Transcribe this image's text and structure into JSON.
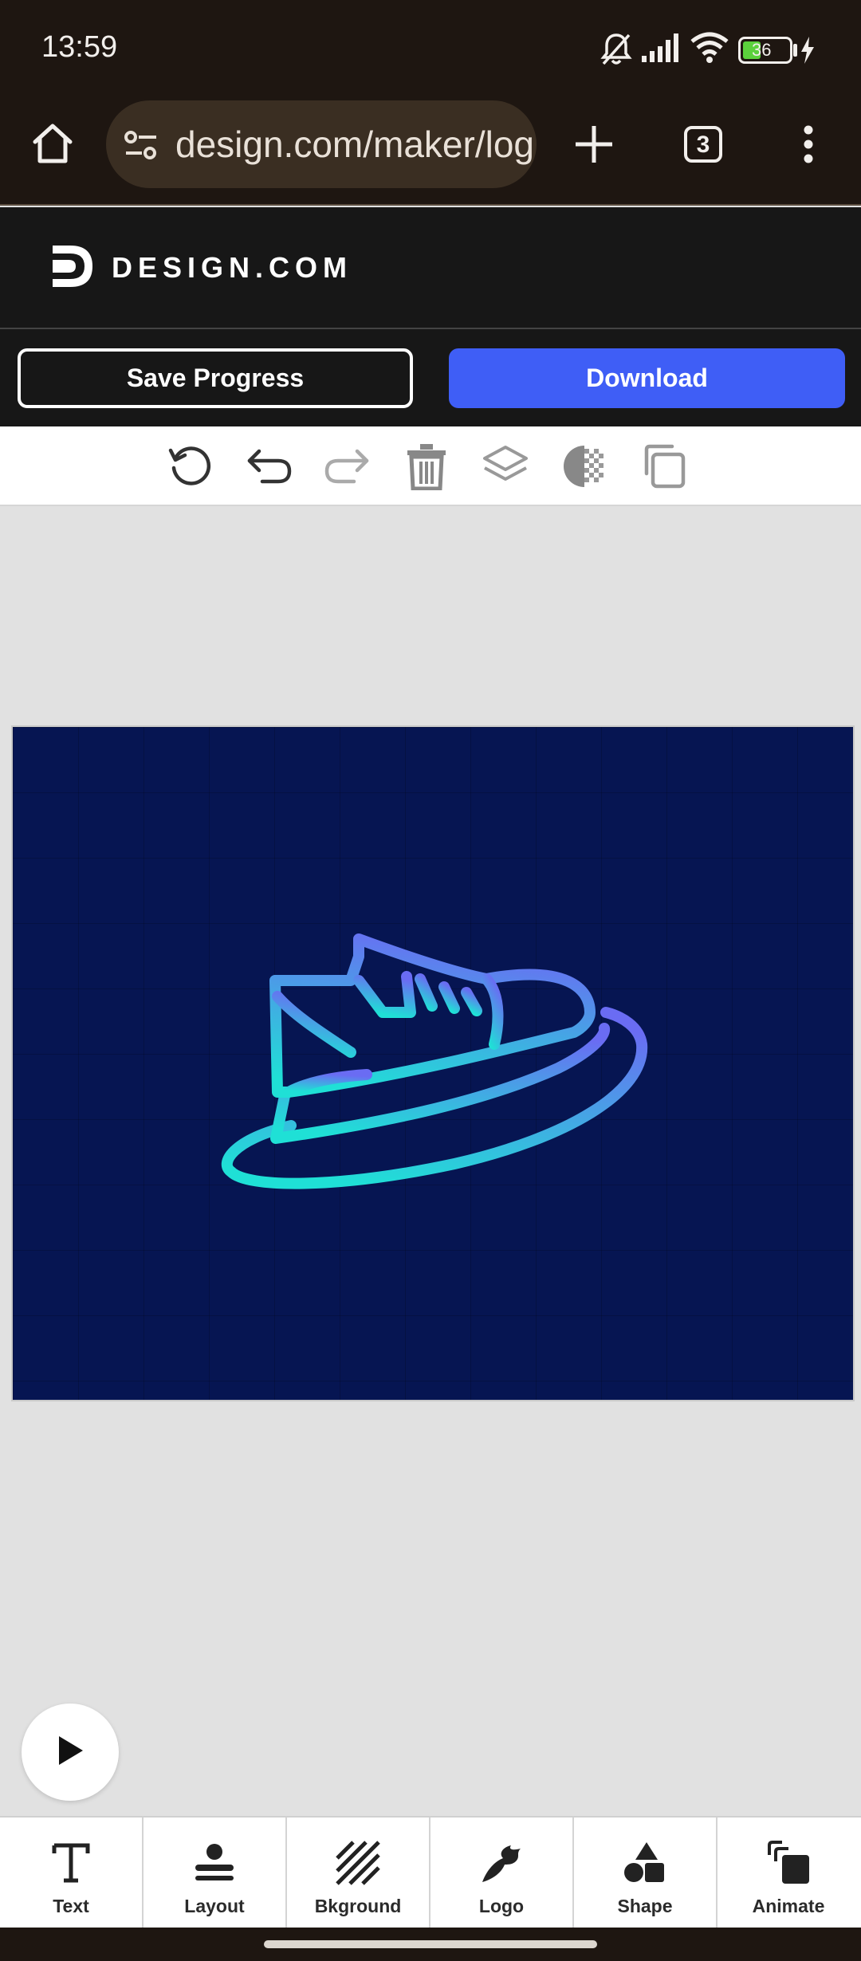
{
  "status_bar": {
    "time": "13:59",
    "battery": "36",
    "icons": [
      "bell-off-icon",
      "signal-icon",
      "wifi-icon",
      "battery-icon",
      "charging-icon"
    ]
  },
  "browser": {
    "url": "design.com/maker/logo",
    "tab_count": "3",
    "icons": [
      "home-icon",
      "site-settings-icon",
      "new-tab-icon",
      "tab-switcher-icon",
      "more-menu-icon"
    ]
  },
  "site": {
    "brand": "DESIGN.COM",
    "brand_color": "#ffffff"
  },
  "actions": {
    "save_label": "Save Progress",
    "download_label": "Download",
    "download_color": "#3f5ef6"
  },
  "toolbar": {
    "tools": [
      "reset-icon",
      "undo-icon",
      "redo-icon",
      "delete-icon",
      "layers-icon",
      "opacity-icon",
      "duplicate-icon"
    ]
  },
  "canvas": {
    "background_color": "#061552",
    "logo": "sneaker-logo",
    "gradient": [
      "#6a6cf3",
      "#1fe0d6"
    ]
  },
  "bottom_nav": {
    "items": [
      {
        "label": "Text",
        "icon": "text-icon"
      },
      {
        "label": "Layout",
        "icon": "layout-icon"
      },
      {
        "label": "Bkground",
        "icon": "background-icon"
      },
      {
        "label": "Logo",
        "icon": "logo-icon"
      },
      {
        "label": "Shape",
        "icon": "shape-icon"
      },
      {
        "label": "Animate",
        "icon": "animate-icon"
      }
    ]
  }
}
